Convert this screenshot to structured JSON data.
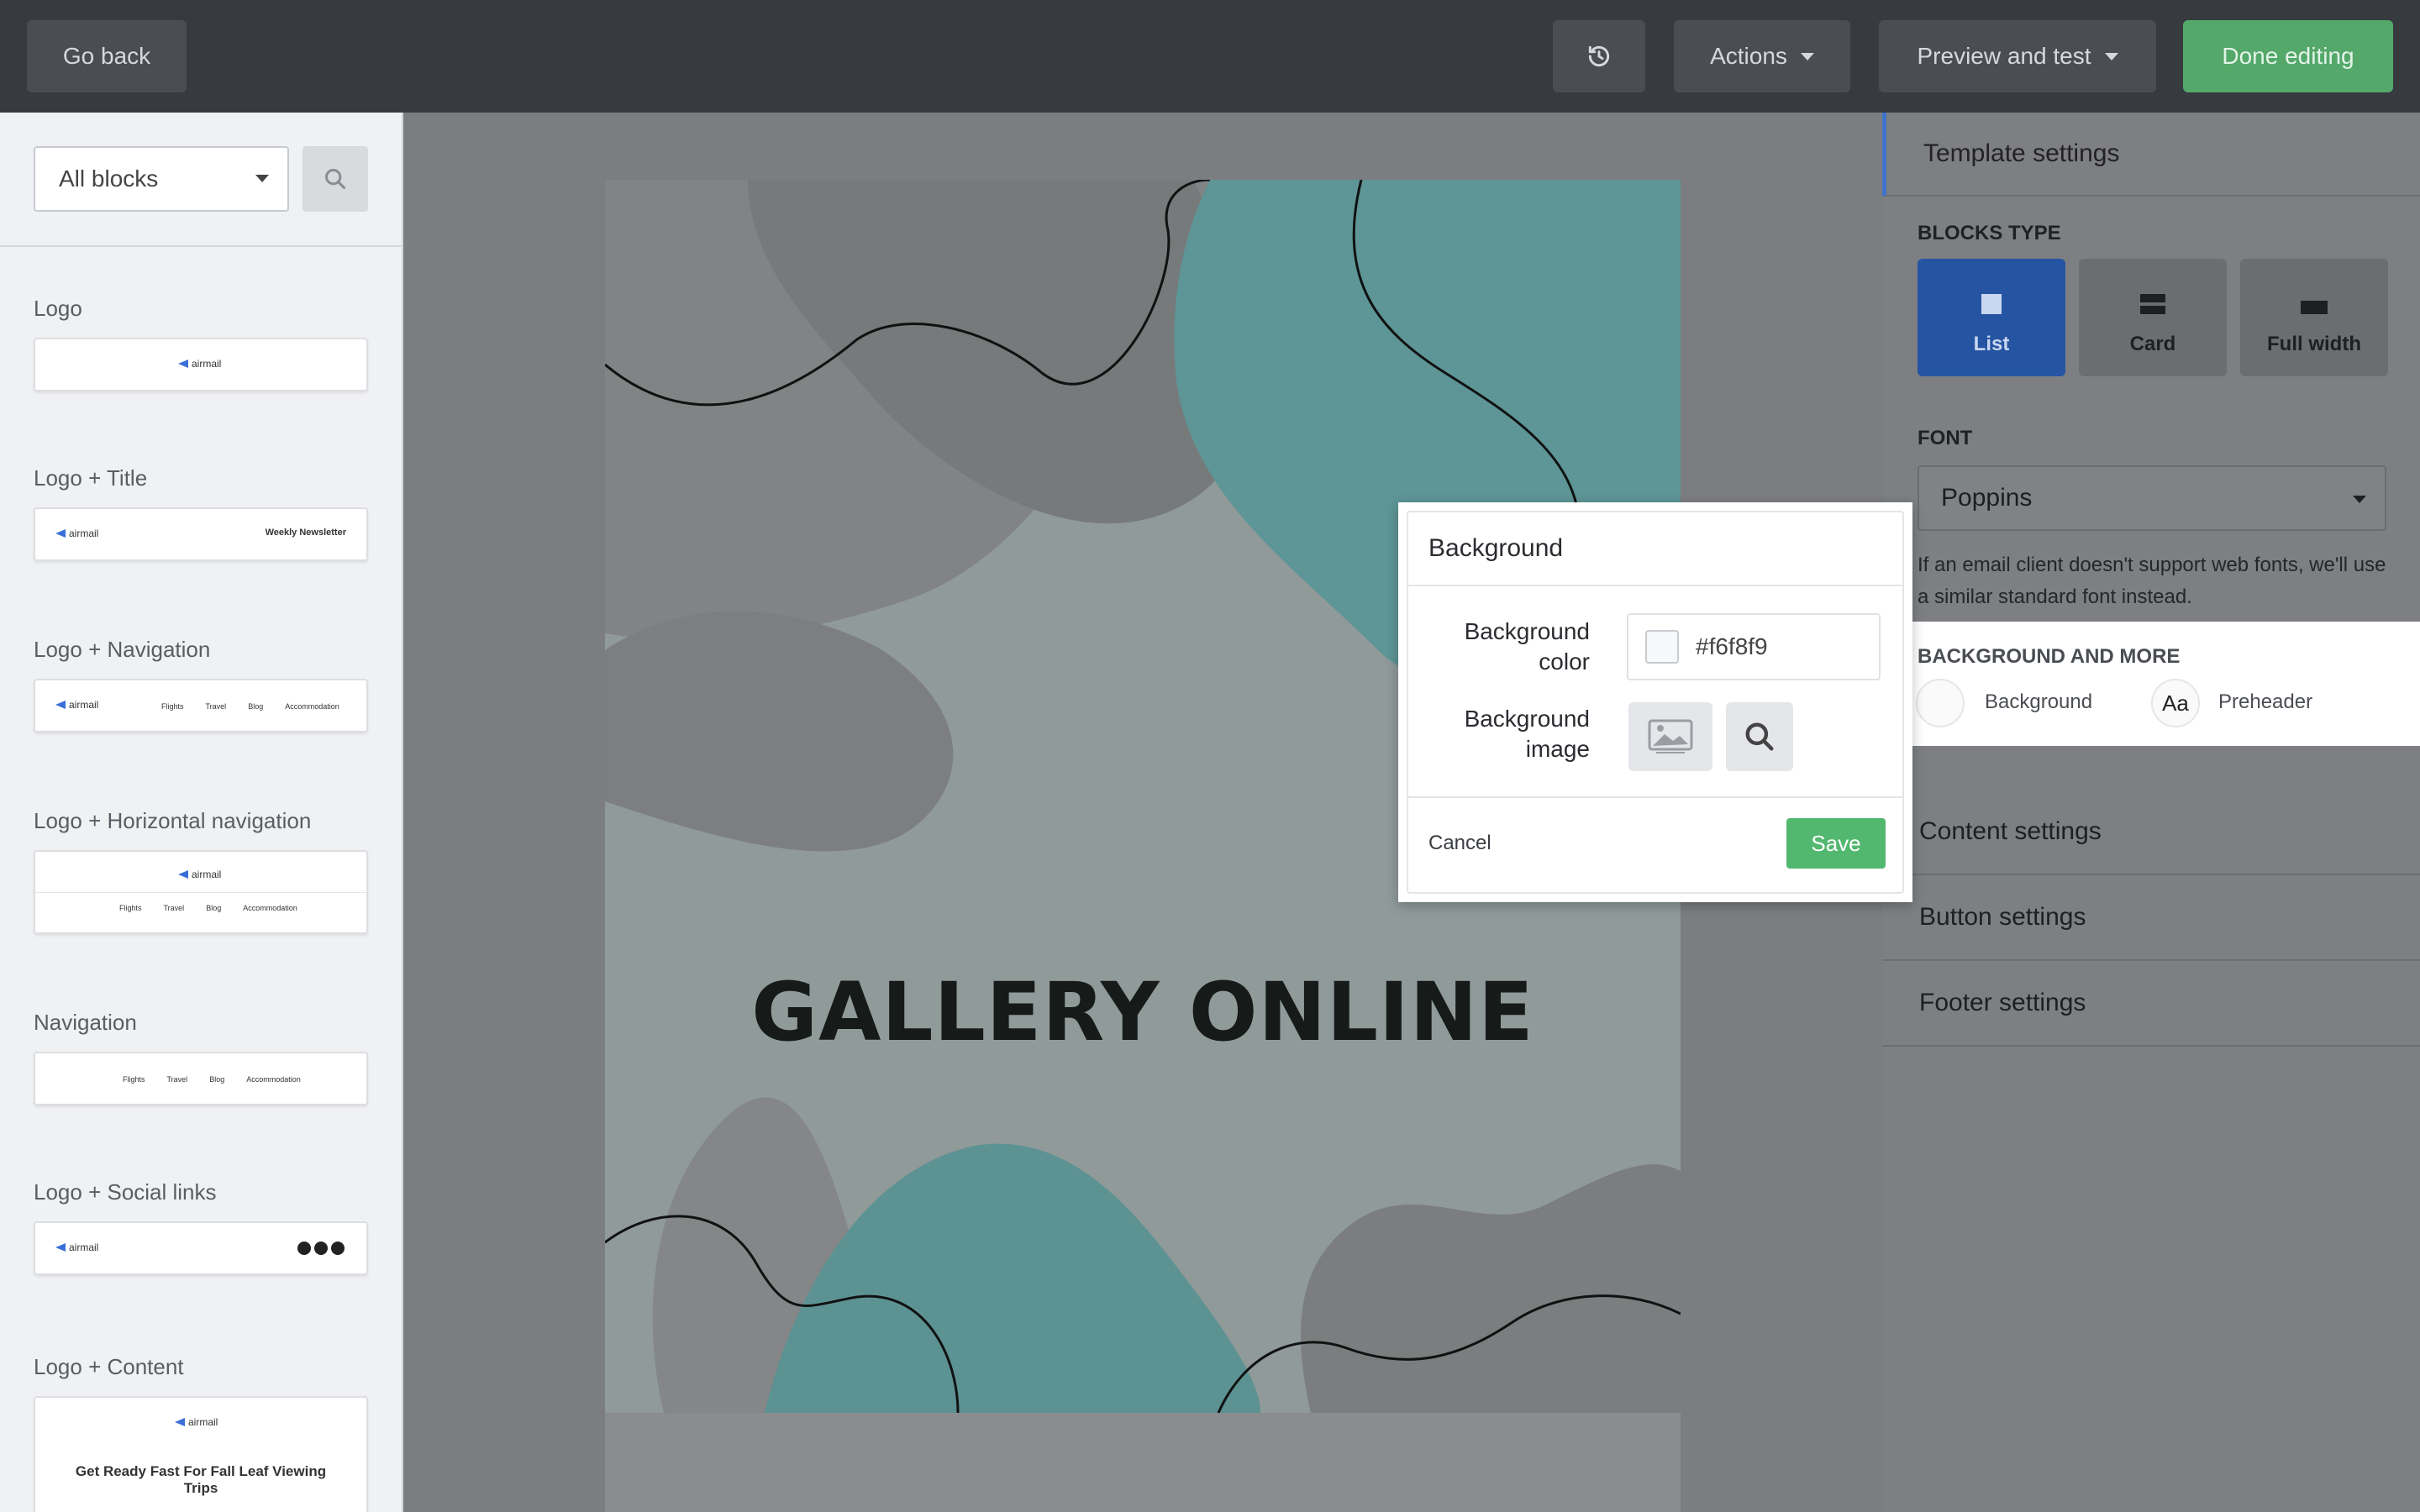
{
  "topbar": {
    "go_back": "Go back",
    "actions": "Actions",
    "preview": "Preview and test",
    "done": "Done editing"
  },
  "sidebar": {
    "filter_selected": "All blocks",
    "blocks": [
      {
        "label": "Logo"
      },
      {
        "label": "Logo + Title",
        "preview_title": "Weekly Newsletter"
      },
      {
        "label": "Logo + Navigation"
      },
      {
        "label": "Logo + Horizontal navigation"
      },
      {
        "label": "Navigation"
      },
      {
        "label": "Logo + Social links"
      },
      {
        "label": "Logo + Content",
        "preview_title": "Get Ready Fast For Fall Leaf Viewing Trips"
      }
    ],
    "brand": "airmail",
    "nav_items": [
      "Flights",
      "Travel",
      "Blog",
      "Accommodation"
    ]
  },
  "email": {
    "hero_title": "GALLERY ONLINE"
  },
  "right_panel": {
    "header": "Template settings",
    "blocks_type_label": "BLOCKS TYPE",
    "block_types": [
      "List",
      "Card",
      "Full width"
    ],
    "font_label": "FONT",
    "font_value": "Poppins",
    "font_note": "If an email client doesn't support web fonts, we'll use a similar standard font instead.",
    "bg_more_label": "BACKGROUND AND MORE",
    "bg_item": "Background",
    "preheader_item": "Preheader",
    "preheader_glyph": "Aa",
    "content_settings": "Content settings",
    "button_settings": "Button settings",
    "footer_settings": "Footer settings"
  },
  "modal": {
    "title": "Background",
    "color_label": "Background color",
    "color_value": "#f6f8f9",
    "image_label": "Background image",
    "cancel": "Cancel",
    "save": "Save"
  },
  "colors": {
    "accent_blue": "#2554a3",
    "save_green": "#53b86f",
    "done_green": "#53a86a",
    "teal": "#5e9a9a"
  }
}
